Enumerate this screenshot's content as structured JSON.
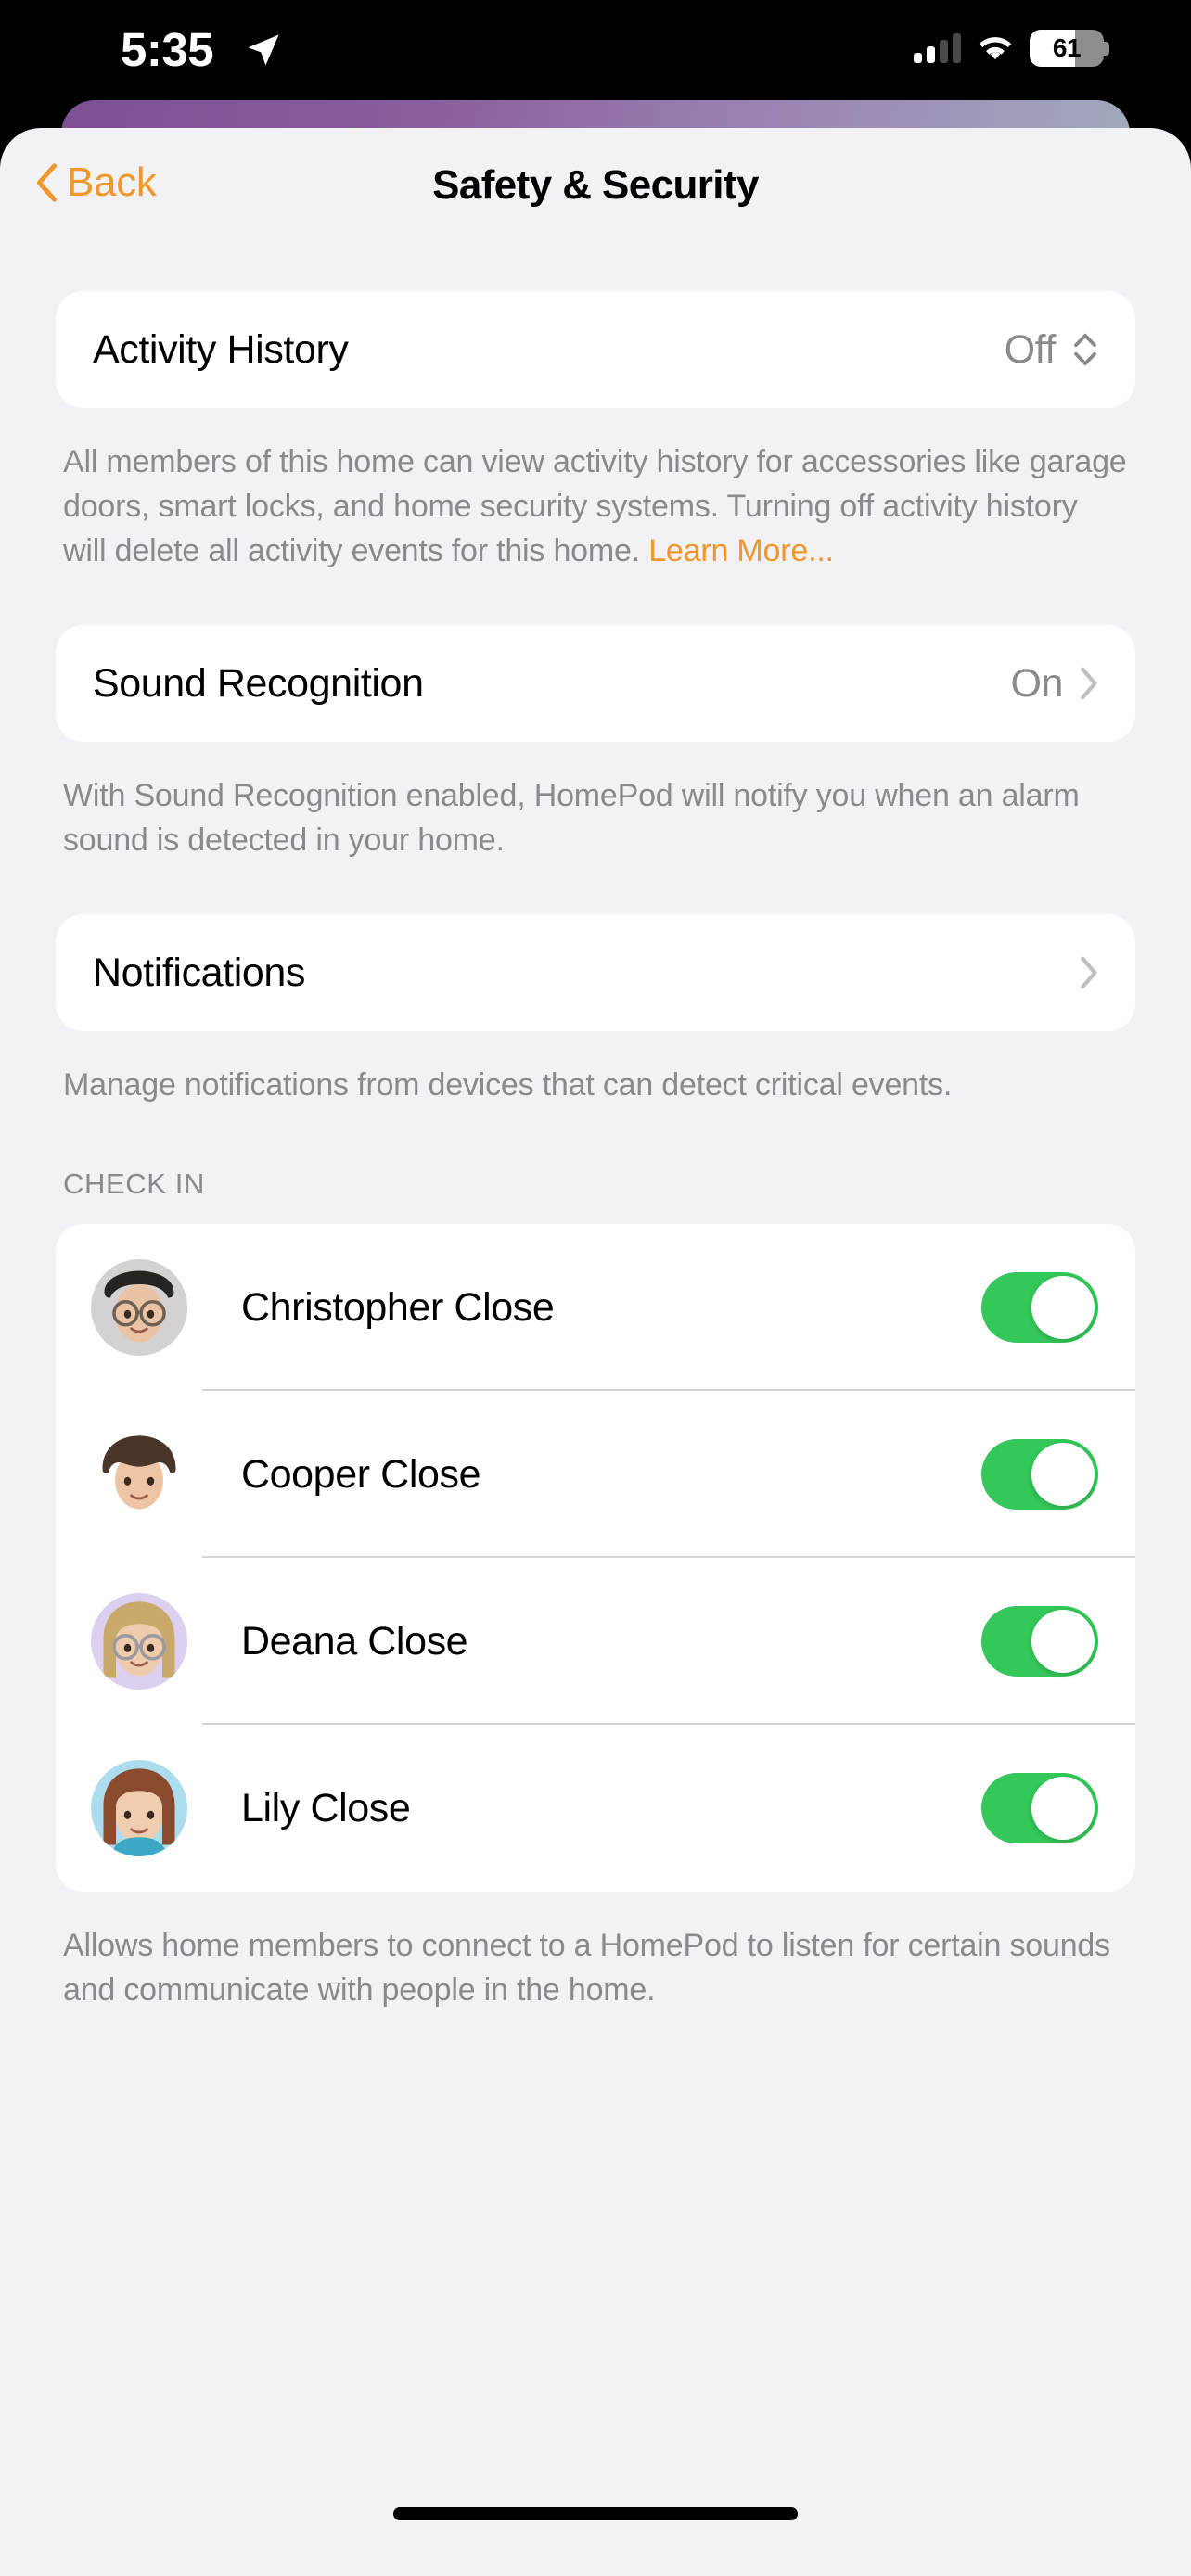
{
  "status_bar": {
    "time": "5:35",
    "location_icon": "location-arrow-icon",
    "signal_icon": "cellular-signal-icon",
    "signal_bars_active": 2,
    "signal_bars_total": 4,
    "wifi_icon": "wifi-icon",
    "battery_percent": "61",
    "battery_level": 61
  },
  "nav": {
    "back_label": "Back",
    "back_icon": "chevron-left-icon",
    "title": "Safety & Security"
  },
  "sections": {
    "activity_history": {
      "title": "Activity History",
      "value": "Off",
      "indicator_icon": "chevron-up-down-icon",
      "footnote": "All members of this home can view activity history for accessories like garage doors, smart locks, and home security systems. Turning off activity history will delete all activity events for this home. ",
      "link_label": "Learn More..."
    },
    "sound_recognition": {
      "title": "Sound Recognition",
      "value": "On",
      "indicator_icon": "chevron-right-icon",
      "footnote": "With Sound Recognition enabled, HomePod will notify you when an alarm sound is detected in your home."
    },
    "notifications": {
      "title": "Notifications",
      "value": "",
      "indicator_icon": "chevron-right-icon",
      "footnote": "Manage notifications from devices that can detect critical events."
    },
    "check_in": {
      "header": "CHECK IN",
      "footnote": "Allows home members to connect to a HomePod to listen for certain sounds and communicate with people in the home.",
      "members": [
        {
          "name": "Christopher Close",
          "avatar_icon": "memoji-avatar",
          "toggle_on": true,
          "avatar": {
            "bg": "#D3D1D1",
            "hair": "#262320",
            "skin": "#E9C3A3",
            "glasses": true,
            "glasses_color": "#6E6257",
            "hair_style": "short",
            "body": ""
          }
        },
        {
          "name": "Cooper Close",
          "avatar_icon": "memoji-avatar",
          "toggle_on": true,
          "avatar": {
            "bg": "#FFFFFF",
            "hair": "#4A3628",
            "skin": "#EDC5A4",
            "glasses": false,
            "glasses_color": "",
            "hair_style": "bowl",
            "body": ""
          }
        },
        {
          "name": "Deana Close",
          "avatar_icon": "memoji-avatar",
          "toggle_on": true,
          "avatar": {
            "bg": "#DCD0F0",
            "hair": "#C9A96A",
            "skin": "#EDCBAC",
            "glasses": true,
            "glasses_color": "#9A9AA0",
            "hair_style": "long",
            "body": ""
          }
        },
        {
          "name": "Lily Close",
          "avatar_icon": "memoji-avatar",
          "toggle_on": true,
          "avatar": {
            "bg": "#AEDCEF",
            "hair": "#8A4A2E",
            "skin": "#F0CDAE",
            "glasses": false,
            "glasses_color": "",
            "hair_style": "long",
            "body": "#3DA8C6"
          }
        }
      ]
    }
  },
  "colors": {
    "accent_orange": "#F0962A",
    "toggle_green": "#34C759",
    "page_bg": "#F2F1F6",
    "card_bg": "#FFFFFF",
    "secondary_text": "#8A8A8E"
  }
}
